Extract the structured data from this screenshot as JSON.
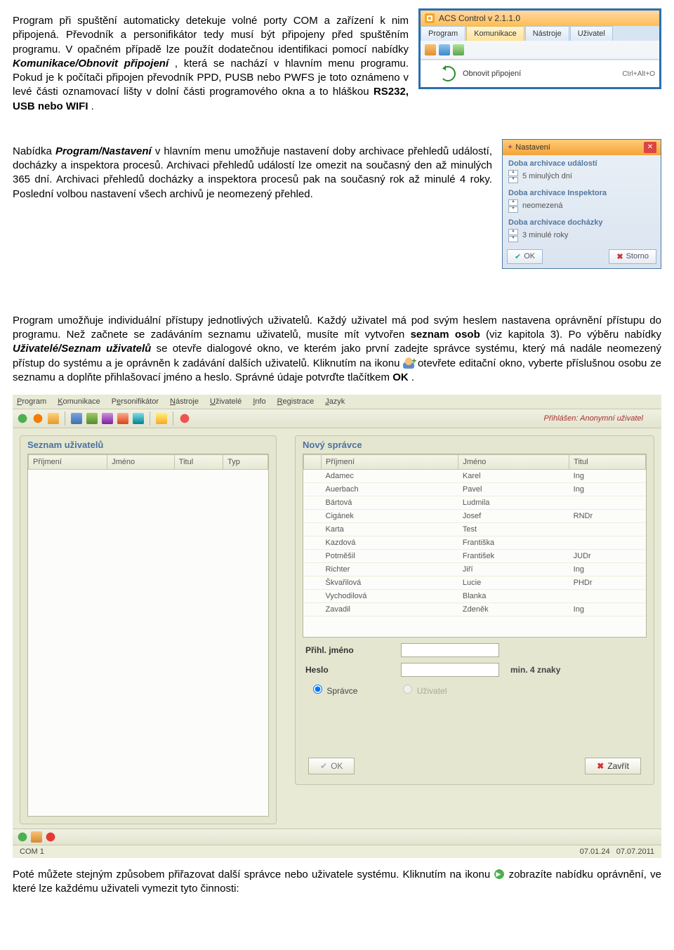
{
  "paragraphs": {
    "p1a": "Program při spuštění automaticky detekuje volné porty COM a zařízení k nim připojená. Převodník a personifikátor tedy musí být připojeny před spuštěním programu. V opačném případě lze použít dodatečnou identifikaci pomocí nabídky ",
    "p1b": "Komunikace/Obnovit připojení",
    "p1c": ", která se nachází v hlavním menu programu. Pokud je k počítači připojen převodník PPD, PUSB nebo PWFS je toto oznámeno v levé části oznamovací lišty v dolní části programového okna a to hláškou ",
    "p1d": "RS232, USB nebo WIFI",
    "p1e": ".",
    "p2a": "Nabídka ",
    "p2b": "Program/Nastavení",
    "p2c": " v hlavním menu umožňuje nastavení doby archivace přehledů událostí, docházky a inspektora procesů. Archivaci přehledů událostí lze omezit na současný den až minulých 365 dní. Archivaci přehledů docházky a inspektora procesů pak na současný rok až minulé 4 roky. Poslední volbou nastavení všech archivů je neomezený přehled.",
    "p3a": "Program umožňuje individuální přístupy jednotlivých uživatelů. Každý uživatel má pod svým heslem nastavena oprávnění přístupu do programu. Než začnete se zadáváním seznamu uživatelů, musíte mít vytvořen ",
    "p3b": "seznam osob",
    "p3c": " (viz kapitola 3). Po výběru nabídky ",
    "p3d": "Uživatelé/Seznam uživatelů",
    "p3e": " se otevře dialogové okno, ve kterém jako první zadejte správce systému, který má nadále neomezený přístup do systému a je oprávněn k zadávání dalších uživatelů. Kliknutím na ikonu ",
    "p3f": " otevřete editační okno, vyberte příslušnou osobu ze seznamu a doplňte přihlašovací jméno a heslo. Správné údaje potvrďte tlačítkem ",
    "p3g": "OK",
    "p3h": ".",
    "p4a": "Poté můžete stejným způsobem přiřazovat další správce nebo uživatele systému. Kliknutím na ikonu ",
    "p4b": " zobrazíte nabídku oprávnění, ve které lze každému uživateli vymezit tyto činnosti:"
  },
  "win1": {
    "title": "ACS Control v 2.1.1.0",
    "menu": [
      "Program",
      "Komunikace",
      "Nástroje",
      "Uživatel"
    ],
    "menu_selected": 1,
    "dropdown": {
      "label": "Obnovit připojení",
      "shortcut": "Ctrl+Alt+O"
    }
  },
  "win2": {
    "title": "Nastavení",
    "groups": [
      {
        "label": "Doba archivace událostí",
        "value": "5 minulých dní"
      },
      {
        "label": "Doba archivace Inspektora",
        "value": "neomezená"
      },
      {
        "label": "Doba archivace docházky",
        "value": "3 minulé roky"
      }
    ],
    "ok": "OK",
    "cancel": "Storno"
  },
  "app3": {
    "menu": [
      "Program",
      "Komunikace",
      "Personifikátor",
      "Nástroje",
      "Uživatelé",
      "Info",
      "Registrace",
      "Jazyk"
    ],
    "login": "Přihlášen: Anonymní uživatel",
    "left": {
      "title": "Seznam uživatelů",
      "cols": [
        "Příjmení",
        "Jméno",
        "Titul",
        "Typ"
      ]
    },
    "right": {
      "title": "Nový správce",
      "cols": [
        "Příjmení",
        "Jméno",
        "Titul"
      ],
      "rows": [
        [
          "Adamec",
          "Karel",
          "Ing"
        ],
        [
          "Auerbach",
          "Pavel",
          "Ing"
        ],
        [
          "Bártová",
          "Ludmila",
          ""
        ],
        [
          "Cigánek",
          "Josef",
          "RNDr"
        ],
        [
          "Karta",
          "Test",
          ""
        ],
        [
          "Kazdová",
          "Františka",
          ""
        ],
        [
          "Potměšil",
          "František",
          "JUDr"
        ],
        [
          "Richter",
          "Jiří",
          "Ing"
        ],
        [
          "Škvařilová",
          "Lucie",
          "PHDr"
        ],
        [
          "Vychodilová",
          "Blanka",
          ""
        ],
        [
          "Zavadil",
          "Zdeněk",
          "Ing"
        ]
      ],
      "login_label": "Přihl. jméno",
      "pass_label": "Heslo",
      "pass_hint": "min. 4 znaky",
      "role_admin": "Správce",
      "role_user": "Uživatel",
      "ok": "OK",
      "close": "Zavřít"
    },
    "status_left": "COM 1",
    "status_date1": "07.01.24",
    "status_date2": "07.07.2011"
  }
}
